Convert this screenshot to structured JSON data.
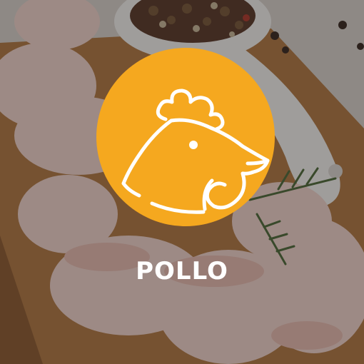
{
  "category": {
    "label": "POLLO",
    "icon": "rooster-head-icon",
    "badge_color": "#F5A81F",
    "icon_color": "#FFFFFF",
    "label_color": "#FFFFFF"
  }
}
